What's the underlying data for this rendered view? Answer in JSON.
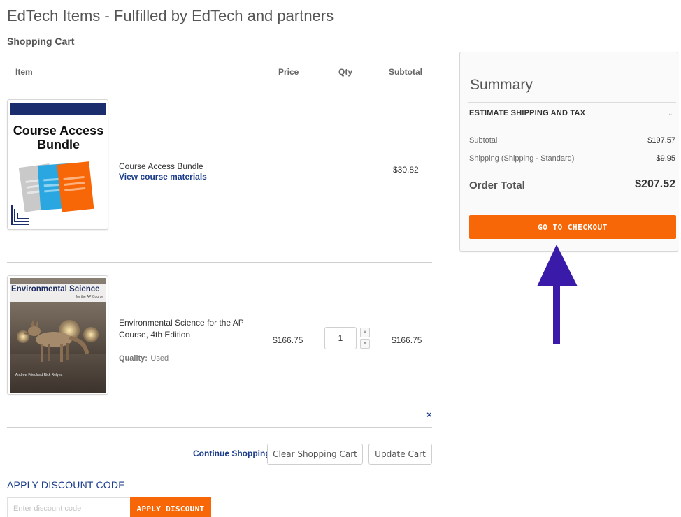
{
  "page": {
    "heading": "EdTech Items - Fulfilled by EdTech and partners",
    "cart_title": "Shopping Cart"
  },
  "table": {
    "headers": {
      "item": "Item",
      "price": "Price",
      "qty": "Qty",
      "subtotal": "Subtotal"
    }
  },
  "items": [
    {
      "thumbnail_text": [
        "Course Access",
        "Bundle"
      ],
      "name": "Course Access Bundle",
      "link": "View course materials",
      "subtotal": "$30.82"
    },
    {
      "thumbnail_text": {
        "title": "Environmental Science",
        "subtitle": "for the AP Course",
        "authors": "Andrew Friedland   Rick Relyea"
      },
      "name": [
        "Environmental Science for the AP",
        "Course, 4th Edition"
      ],
      "quality_label": "Quality:",
      "quality_value": "Used",
      "price": "$166.75",
      "qty": "1",
      "subtotal": "$166.75"
    }
  ],
  "actions": {
    "remove": "×",
    "continue_shopping": "Continue Shopping",
    "clear_cart": "Clear Shopping Cart",
    "update_cart": "Update Cart"
  },
  "discount": {
    "title": "APPLY DISCOUNT CODE",
    "placeholder": "Enter discount code",
    "button": "APPLY DISCOUNT"
  },
  "summary": {
    "title": "Summary",
    "estimate": "ESTIMATE SHIPPING AND TAX",
    "subtotal_label": "Subtotal",
    "subtotal_value": "$197.57",
    "shipping_label": "Shipping (Shipping - Standard)",
    "shipping_value": "$9.95",
    "total_label": "Order Total",
    "total_value": "$207.52",
    "checkout_button": "GO TO CHECKOUT"
  },
  "colors": {
    "accent_orange": "#f76707",
    "link_blue": "#1a3c8a",
    "annotation_arrow": "#3a1aa8"
  }
}
